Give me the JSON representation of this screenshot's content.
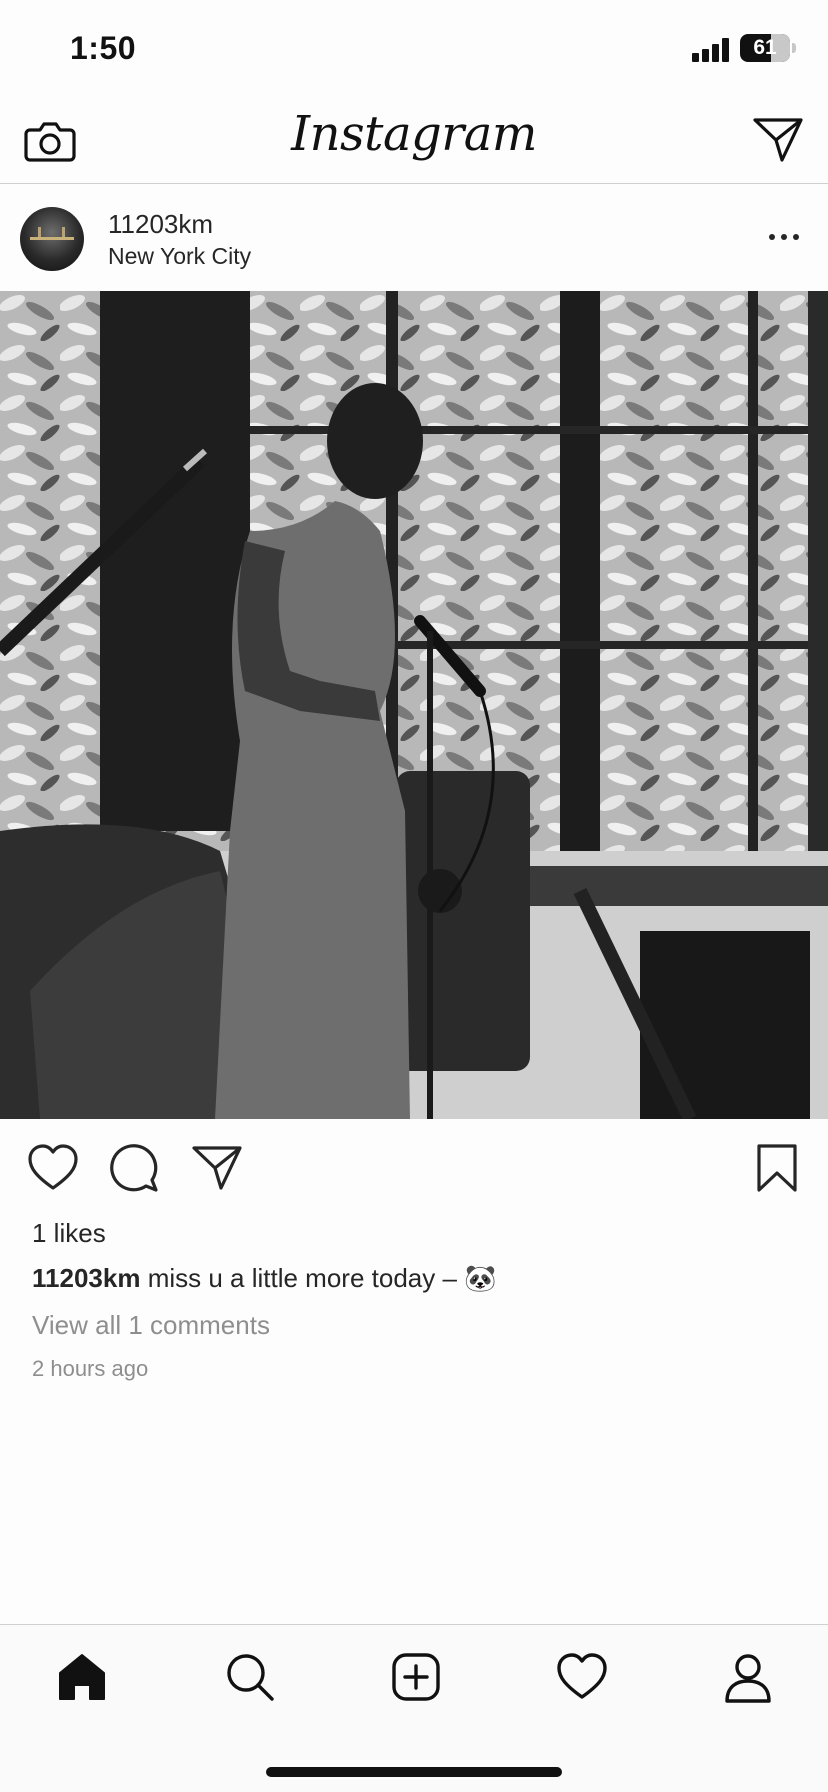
{
  "status_bar": {
    "time": "1:50",
    "battery": "61",
    "battery_level": 0.61
  },
  "nav": {
    "logo": "Instagram",
    "left_icon": "camera-icon",
    "right_icon": "send-icon"
  },
  "post": {
    "username": "11203km",
    "location": "New York City",
    "menu_icon": "more-icon",
    "photo_description_icon": "photo",
    "likes": "1 likes",
    "caption_user": "11203km",
    "caption_text": "miss u a little more today – 🐼",
    "view_comments": "View all 1 comments",
    "timestamp": "2 hours ago"
  },
  "actions": [
    "heart-icon",
    "comment-icon",
    "share-icon",
    "bookmark-icon"
  ],
  "tab_bar": [
    "home-icon",
    "search-icon",
    "add-post-icon",
    "activity-heart-icon",
    "profile-icon"
  ],
  "colors": {
    "text": "#262626",
    "muted": "#8e8e8e",
    "divider": "#d0d0d0",
    "background": "#fdfdfd"
  }
}
